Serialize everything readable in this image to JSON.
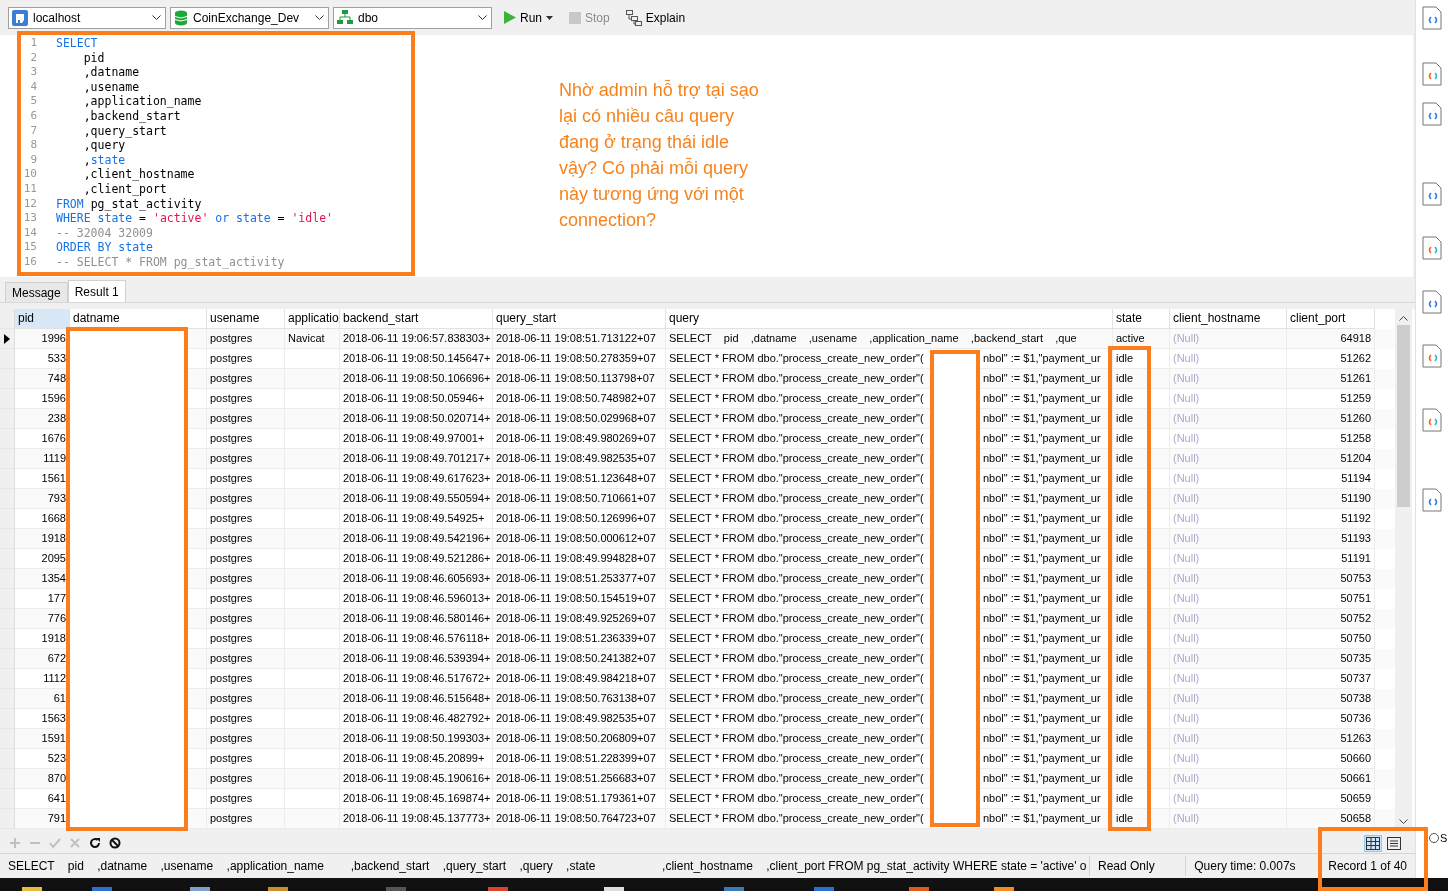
{
  "toolbar": {
    "selectors": [
      {
        "kind": "connection",
        "value": "localhost"
      },
      {
        "kind": "database",
        "value": "CoinExchange_Dev"
      },
      {
        "kind": "schema",
        "value": "dbo"
      }
    ],
    "buttons": [
      {
        "kind": "run",
        "label": "Run",
        "disabled": false
      },
      {
        "kind": "stop",
        "label": "Stop",
        "disabled": true
      },
      {
        "kind": "explain",
        "label": "Explain",
        "disabled": false
      }
    ]
  },
  "editor": {
    "lines": [
      {
        "number": "1",
        "tokens": [
          {
            "kind": "keyword",
            "text": "SELECT"
          }
        ]
      },
      {
        "number": "2",
        "tokens": [
          {
            "kind": "plain",
            "text": "    pid"
          }
        ]
      },
      {
        "number": "3",
        "tokens": [
          {
            "kind": "plain",
            "text": "    ,datname"
          }
        ]
      },
      {
        "number": "4",
        "tokens": [
          {
            "kind": "plain",
            "text": "    ,usename"
          }
        ]
      },
      {
        "number": "5",
        "tokens": [
          {
            "kind": "plain",
            "text": "    ,application_name"
          }
        ]
      },
      {
        "number": "6",
        "tokens": [
          {
            "kind": "plain",
            "text": "    ,backend_start"
          }
        ]
      },
      {
        "number": "7",
        "tokens": [
          {
            "kind": "plain",
            "text": "    ,query_start"
          }
        ]
      },
      {
        "number": "8",
        "tokens": [
          {
            "kind": "plain",
            "text": "    ,query"
          }
        ]
      },
      {
        "number": "9",
        "tokens": [
          {
            "kind": "plain",
            "text": "    ,"
          },
          {
            "kind": "keyword",
            "text": "state"
          }
        ]
      },
      {
        "number": "10",
        "tokens": [
          {
            "kind": "plain",
            "text": "    ,client_hostname"
          }
        ]
      },
      {
        "number": "11",
        "tokens": [
          {
            "kind": "plain",
            "text": "    ,client_port"
          }
        ]
      },
      {
        "number": "12",
        "tokens": [
          {
            "kind": "keyword",
            "text": "FROM"
          },
          {
            "kind": "plain",
            "text": " pg_stat_activity"
          }
        ]
      },
      {
        "number": "13",
        "tokens": [
          {
            "kind": "keyword",
            "text": "WHERE state"
          },
          {
            "kind": "plain",
            "text": " = "
          },
          {
            "kind": "string",
            "text": "'active'"
          },
          {
            "kind": "keyword",
            "text": " or state"
          },
          {
            "kind": "plain",
            "text": " = "
          },
          {
            "kind": "string",
            "text": "'idle'"
          }
        ]
      },
      {
        "number": "14",
        "tokens": [
          {
            "kind": "comment",
            "text": "-- 32004 32009"
          }
        ]
      },
      {
        "number": "15",
        "tokens": [
          {
            "kind": "keyword",
            "text": "ORDER BY state"
          }
        ]
      },
      {
        "number": "16",
        "tokens": [
          {
            "kind": "comment",
            "text": "-- SELECT * FROM pg_stat_activity"
          }
        ]
      }
    ],
    "note": "Nhờ admin hỗ trợ tại sạo lại có nhiều câu query đang ở trạng thái idle vậy? Có phải mỗi query này tương ứng với một connection?"
  },
  "tabs": [
    {
      "label": "Message",
      "selected": false
    },
    {
      "label": "Result 1",
      "selected": true
    }
  ],
  "table": {
    "columns": [
      "pid",
      "datname",
      "usename",
      "applicatio",
      "backend_start",
      "query_start",
      "query",
      "state",
      "client_hostname",
      "client_port"
    ],
    "rows": [
      {
        "selected": true,
        "pid": "1996",
        "usename": "postgres",
        "application_name": "Navicat",
        "backend_start": "2018-06-11 19:06:57.838303+",
        "query_start": "2018-06-11 19:08:51.713122+07",
        "query": "SELECT    pid    ,datname    ,usename    ,application_name    ,backend_start    ,que",
        "state": "active",
        "client_hostname": "(Null)",
        "client_port": "64918"
      },
      {
        "selected": false,
        "pid": "533",
        "usename": "postgres",
        "backend_start": "2018-06-11 19:08:50.145647+",
        "query_start": "2018-06-11 19:08:50.278359+07",
        "query": "SELECT * FROM dbo.\"process_create_new_order\"(",
        "query_tail": "nbol\" := $1,\"payment_ur",
        "state": "idle",
        "client_hostname": "(Null)",
        "client_port": "51262"
      },
      {
        "selected": false,
        "pid": "748",
        "usename": "postgres",
        "backend_start": "2018-06-11 19:08:50.106696+",
        "query_start": "2018-06-11 19:08:50.113798+07",
        "query": "SELECT * FROM dbo.\"process_create_new_order\"(",
        "query_tail": "nbol\" := $1,\"payment_ur",
        "state": "idle",
        "client_hostname": "(Null)",
        "client_port": "51261"
      },
      {
        "selected": false,
        "pid": "1596",
        "usename": "postgres",
        "backend_start": "2018-06-11 19:08:50.05946+",
        "query_start": "2018-06-11 19:08:50.748982+07",
        "query": "SELECT * FROM dbo.\"process_create_new_order\"(",
        "query_tail": "nbol\" := $1,\"payment_ur",
        "state": "idle",
        "client_hostname": "(Null)",
        "client_port": "51259"
      },
      {
        "selected": false,
        "pid": "238",
        "usename": "postgres",
        "backend_start": "2018-06-11 19:08:50.020714+",
        "query_start": "2018-06-11 19:08:50.029968+07",
        "query": "SELECT * FROM dbo.\"process_create_new_order\"(",
        "query_tail": "nbol\" := $1,\"payment_ur",
        "state": "idle",
        "client_hostname": "(Null)",
        "client_port": "51260"
      },
      {
        "selected": false,
        "pid": "1676",
        "usename": "postgres",
        "backend_start": "2018-06-11 19:08:49.97001+",
        "query_start": "2018-06-11 19:08:49.980269+07",
        "query": "SELECT * FROM dbo.\"process_create_new_order\"(",
        "query_tail": "nbol\" := $1,\"payment_ur",
        "state": "idle",
        "client_hostname": "(Null)",
        "client_port": "51258"
      },
      {
        "selected": false,
        "pid": "1119",
        "usename": "postgres",
        "backend_start": "2018-06-11 19:08:49.701217+",
        "query_start": "2018-06-11 19:08:49.982535+07",
        "query": "SELECT * FROM dbo.\"process_create_new_order\"(",
        "query_tail": "nbol\" := $1,\"payment_ur",
        "state": "idle",
        "client_hostname": "(Null)",
        "client_port": "51204"
      },
      {
        "selected": false,
        "pid": "1561",
        "usename": "postgres",
        "backend_start": "2018-06-11 19:08:49.617623+",
        "query_start": "2018-06-11 19:08:51.123648+07",
        "query": "SELECT * FROM dbo.\"process_create_new_order\"(",
        "query_tail": "nbol\" := $1,\"payment_ur",
        "state": "idle",
        "client_hostname": "(Null)",
        "client_port": "51194"
      },
      {
        "selected": false,
        "pid": "793",
        "usename": "postgres",
        "backend_start": "2018-06-11 19:08:49.550594+",
        "query_start": "2018-06-11 19:08:50.710661+07",
        "query": "SELECT * FROM dbo.\"process_create_new_order\"(",
        "query_tail": "nbol\" := $1,\"payment_ur",
        "state": "idle",
        "client_hostname": "(Null)",
        "client_port": "51190"
      },
      {
        "selected": false,
        "pid": "1668",
        "usename": "postgres",
        "backend_start": "2018-06-11 19:08:49.54925+",
        "query_start": "2018-06-11 19:08:50.126996+07",
        "query": "SELECT * FROM dbo.\"process_create_new_order\"(",
        "query_tail": "nbol\" := $1,\"payment_ur",
        "state": "idle",
        "client_hostname": "(Null)",
        "client_port": "51192"
      },
      {
        "selected": false,
        "pid": "1918",
        "usename": "postgres",
        "backend_start": "2018-06-11 19:08:49.542196+",
        "query_start": "2018-06-11 19:08:50.000612+07",
        "query": "SELECT * FROM dbo.\"process_create_new_order\"(",
        "query_tail": "nbol\" := $1,\"payment_ur",
        "state": "idle",
        "client_hostname": "(Null)",
        "client_port": "51193"
      },
      {
        "selected": false,
        "pid": "2095",
        "usename": "postgres",
        "backend_start": "2018-06-11 19:08:49.521286+",
        "query_start": "2018-06-11 19:08:49.994828+07",
        "query": "SELECT * FROM dbo.\"process_create_new_order\"(",
        "query_tail": "nbol\" := $1,\"payment_ur",
        "state": "idle",
        "client_hostname": "(Null)",
        "client_port": "51191"
      },
      {
        "selected": false,
        "pid": "1354",
        "usename": "postgres",
        "backend_start": "2018-06-11 19:08:46.605693+",
        "query_start": "2018-06-11 19:08:51.253377+07",
        "query": "SELECT * FROM dbo.\"process_create_new_order\"(",
        "query_tail": "nbol\" := $1,\"payment_ur",
        "state": "idle",
        "client_hostname": "(Null)",
        "client_port": "50753"
      },
      {
        "selected": false,
        "pid": "177",
        "usename": "postgres",
        "backend_start": "2018-06-11 19:08:46.596013+",
        "query_start": "2018-06-11 19:08:50.154519+07",
        "query": "SELECT * FROM dbo.\"process_create_new_order\"(",
        "query_tail": "nbol\" := $1,\"payment_ur",
        "state": "idle",
        "client_hostname": "(Null)",
        "client_port": "50751"
      },
      {
        "selected": false,
        "pid": "776",
        "usename": "postgres",
        "backend_start": "2018-06-11 19:08:46.580146+",
        "query_start": "2018-06-11 19:08:49.925269+07",
        "query": "SELECT * FROM dbo.\"process_create_new_order\"(",
        "query_tail": "nbol\" := $1,\"payment_ur",
        "state": "idle",
        "client_hostname": "(Null)",
        "client_port": "50752"
      },
      {
        "selected": false,
        "pid": "1918",
        "usename": "postgres",
        "backend_start": "2018-06-11 19:08:46.576118+",
        "query_start": "2018-06-11 19:08:51.236339+07",
        "query": "SELECT * FROM dbo.\"process_create_new_order\"(",
        "query_tail": "nbol\" := $1,\"payment_ur",
        "state": "idle",
        "client_hostname": "(Null)",
        "client_port": "50750"
      },
      {
        "selected": false,
        "pid": "672",
        "usename": "postgres",
        "backend_start": "2018-06-11 19:08:46.539394+",
        "query_start": "2018-06-11 19:08:50.241382+07",
        "query": "SELECT * FROM dbo.\"process_create_new_order\"(",
        "query_tail": "nbol\" := $1,\"payment_ur",
        "state": "idle",
        "client_hostname": "(Null)",
        "client_port": "50735"
      },
      {
        "selected": false,
        "pid": "1112",
        "usename": "postgres",
        "backend_start": "2018-06-11 19:08:46.517672+",
        "query_start": "2018-06-11 19:08:49.984218+07",
        "query": "SELECT * FROM dbo.\"process_create_new_order\"(",
        "query_tail": "nbol\" := $1,\"payment_ur",
        "state": "idle",
        "client_hostname": "(Null)",
        "client_port": "50737"
      },
      {
        "selected": false,
        "pid": "61",
        "usename": "postgres",
        "backend_start": "2018-06-11 19:08:46.515648+",
        "query_start": "2018-06-11 19:08:50.763138+07",
        "query": "SELECT * FROM dbo.\"process_create_new_order\"(",
        "query_tail": "nbol\" := $1,\"payment_ur",
        "state": "idle",
        "client_hostname": "(Null)",
        "client_port": "50738"
      },
      {
        "selected": false,
        "pid": "1563",
        "usename": "postgres",
        "backend_start": "2018-06-11 19:08:46.482792+",
        "query_start": "2018-06-11 19:08:49.982535+07",
        "query": "SELECT * FROM dbo.\"process_create_new_order\"(",
        "query_tail": "nbol\" := $1,\"payment_ur",
        "state": "idle",
        "client_hostname": "(Null)",
        "client_port": "50736"
      },
      {
        "selected": false,
        "pid": "1591",
        "usename": "postgres",
        "backend_start": "2018-06-11 19:08:50.199303+",
        "query_start": "2018-06-11 19:08:50.206809+07",
        "query": "SELECT * FROM dbo.\"process_create_new_order\"(",
        "query_tail": "nbol\" := $1,\"payment_ur",
        "state": "idle",
        "client_hostname": "(Null)",
        "client_port": "51263"
      },
      {
        "selected": false,
        "pid": "523",
        "usename": "postgres",
        "backend_start": "2018-06-11 19:08:45.20899+",
        "query_start": "2018-06-11 19:08:51.228399+07",
        "query": "SELECT * FROM dbo.\"process_create_new_order\"(",
        "query_tail": "nbol\" := $1,\"payment_ur",
        "state": "idle",
        "client_hostname": "(Null)",
        "client_port": "50660"
      },
      {
        "selected": false,
        "pid": "870",
        "usename": "postgres",
        "backend_start": "2018-06-11 19:08:45.190616+",
        "query_start": "2018-06-11 19:08:51.256683+07",
        "query": "SELECT * FROM dbo.\"process_create_new_order\"(",
        "query_tail": "nbol\" := $1,\"payment_ur",
        "state": "idle",
        "client_hostname": "(Null)",
        "client_port": "50661"
      },
      {
        "selected": false,
        "pid": "641",
        "usename": "postgres",
        "backend_start": "2018-06-11 19:08:45.169874+",
        "query_start": "2018-06-11 19:08:51.179361+07",
        "query": "SELECT * FROM dbo.\"process_create_new_order\"(",
        "query_tail": "nbol\" := $1,\"payment_ur",
        "state": "idle",
        "client_hostname": "(Null)",
        "client_port": "50659"
      },
      {
        "selected": false,
        "pid": "791",
        "usename": "postgres",
        "backend_start": "2018-06-11 19:08:45.137773+",
        "query_start": "2018-06-11 19:08:50.764723+07",
        "query": "SELECT * FROM dbo.\"process_create_new_order\"(",
        "query_tail": "nbol\" := $1,\"payment_ur",
        "state": "idle",
        "client_hostname": "(Null)",
        "client_port": "50658"
      }
    ]
  },
  "grid_toolbar": {
    "buttons": [
      {
        "kind": "add",
        "disabled": true
      },
      {
        "kind": "remove",
        "disabled": true
      },
      {
        "kind": "apply",
        "disabled": true
      },
      {
        "kind": "discard",
        "disabled": true
      },
      {
        "kind": "refresh",
        "disabled": false
      },
      {
        "kind": "stop",
        "disabled": false
      }
    ],
    "views": [
      {
        "kind": "grid",
        "selected": true
      },
      {
        "kind": "form",
        "selected": false
      }
    ]
  },
  "status_bar": {
    "sql": "SELECT    pid    ,datname    ,usename    ,application_name        ,backend_start    ,query_start    ,query    ,state                    ,client_hostname    ,client_port FROM pg_stat_activity WHERE state = 'active' o",
    "mode": "Read Only",
    "query_time": "Query time: 0.007s",
    "record": "Record 1 of 40"
  },
  "side_panel": {
    "files": [
      {
        "kind": "blue"
      },
      {
        "kind": "multicolor"
      },
      {
        "kind": "blue"
      },
      {
        "kind": "blue"
      },
      {
        "kind": "multicolor"
      },
      {
        "kind": "blue"
      },
      {
        "kind": "multicolor"
      },
      {
        "kind": "multicolor"
      },
      {
        "kind": "blue"
      }
    ],
    "option_label": "S",
    "option_selected": false
  }
}
